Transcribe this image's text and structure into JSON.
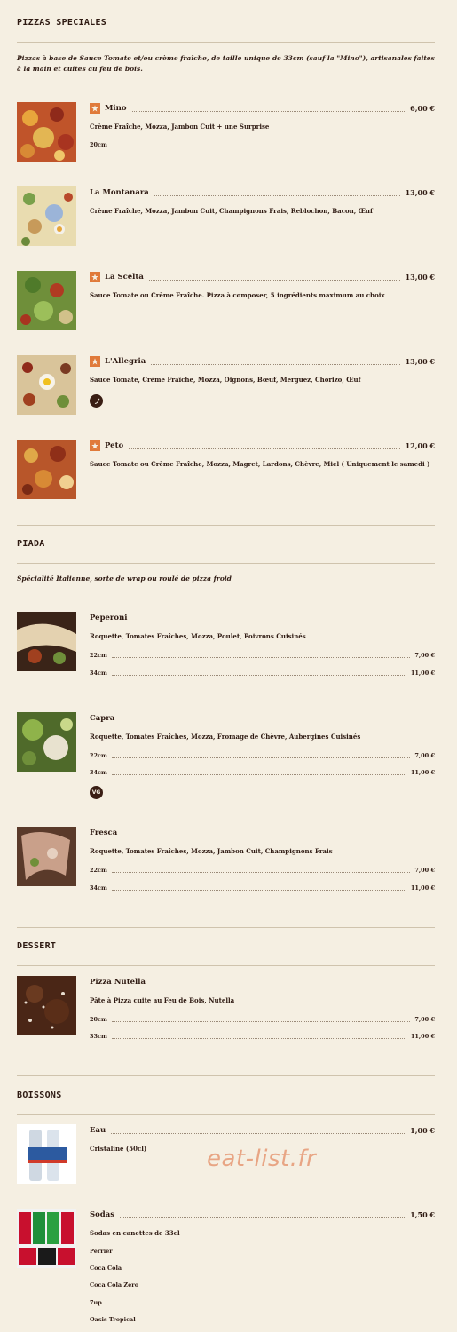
{
  "sections": {
    "pizzas": {
      "title": "PIZZAS SPECIALES",
      "description": "Pizzas à base de Sauce Tomate et/ou crème fraîche, de taille unique de 33cm (sauf la \"Mino\"), artisanales faites à la main et cuites au feu de bois.",
      "items": [
        {
          "name": "Mino",
          "price": "6,00 €",
          "description": "Crème Fraîche, Mozza, Jambon Cuit + une Surprise",
          "extra": "20cm",
          "featured": true
        },
        {
          "name": "La Montanara",
          "price": "13,00 €",
          "description": "Crème Fraîche, Mozza, Jambon Cuit, Champignons Frais, Reblochon, Bacon, Œuf",
          "featured": false
        },
        {
          "name": "La Scelta",
          "price": "13,00 €",
          "description": "Sauce Tomate ou Crème Fraîche. Pizza à composer, 5 ingrédients maximum au choix",
          "featured": true
        },
        {
          "name": "L'Allegria",
          "price": "13,00 €",
          "description": "Sauce Tomate, Crème Fraîche, Mozza, Oignons, Bœuf, Merguez, Chorizo, Œuf",
          "featured": true,
          "badge_icon": "chili-pepper-icon"
        },
        {
          "name": "Peto",
          "price": "12,00 €",
          "description": "Sauce Tomate ou Crème Fraîche, Mozza, Magret, Lardons, Chèvre, Miel ( Uniquement le samedi )",
          "featured": true
        }
      ]
    },
    "piada": {
      "title": "PIADA",
      "description": "Spécialité Italienne, sorte de wrap ou roulé de pizza froid",
      "items": [
        {
          "name": "Peperoni",
          "description": "Roquette, Tomates Fraîches, Mozza, Poulet, Poivrons Cuisinés",
          "sizes": [
            {
              "label": "22cm",
              "price": "7,00 €"
            },
            {
              "label": "34cm",
              "price": "11,00 €"
            }
          ]
        },
        {
          "name": "Capra",
          "description": "Roquette, Tomates Fraîches, Mozza, Fromage de Chèvre, Aubergines Cuisinés",
          "sizes": [
            {
              "label": "22cm",
              "price": "7,00 €"
            },
            {
              "label": "34cm",
              "price": "11,00 €"
            }
          ],
          "badge": "VG"
        },
        {
          "name": "Fresca",
          "description": "Roquette, Tomates Fraîches, Mozza, Jambon Cuit, Champignons Frais",
          "sizes": [
            {
              "label": "22cm",
              "price": "7,00 €"
            },
            {
              "label": "34cm",
              "price": "11,00 €"
            }
          ]
        }
      ]
    },
    "dessert": {
      "title": "DESSERT",
      "items": [
        {
          "name": "Pizza Nutella",
          "description": "Pâte à Pizza cuite au Feu de Bois, Nutella",
          "sizes": [
            {
              "label": "20cm",
              "price": "7,00 €"
            },
            {
              "label": "33cm",
              "price": "11,00 €"
            }
          ]
        }
      ]
    },
    "boissons": {
      "title": "BOISSONS",
      "items": [
        {
          "name": "Eau",
          "price": "1,00 €",
          "description": "Cristaline (50cl)"
        },
        {
          "name": "Sodas",
          "price": "1,50 €",
          "description": "Sodas en canettes de 33cl",
          "options": [
            "Perrier",
            "Coca Cola",
            "Coca Cola Zero",
            "7up",
            "Oasis Tropical"
          ]
        }
      ]
    }
  },
  "watermark": "eat-list.fr",
  "colors": {
    "background": "#f5efe2",
    "text": "#2e1a12",
    "accent": "#e07a3a",
    "rule": "#cfc3ad",
    "watermark": "#e8a584"
  },
  "icons": {
    "featured": "star-icon",
    "vegetarian": "vg-badge-icon",
    "spicy": "chili-pepper-icon"
  }
}
